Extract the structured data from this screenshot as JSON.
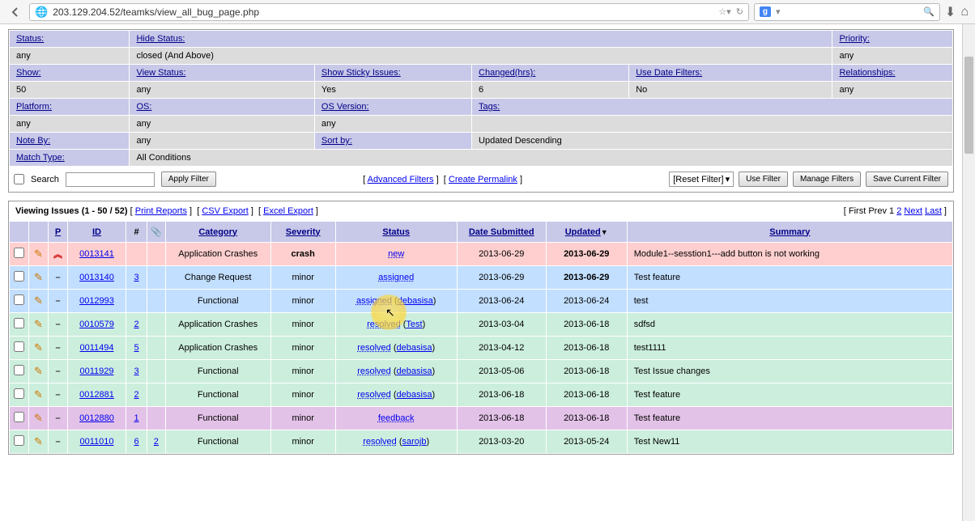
{
  "browser": {
    "url": "203.129.204.52/teamks/view_all_bug_page.php",
    "search_engine": "g"
  },
  "filter": {
    "row0": {
      "status": "Status:",
      "hide": "Hide Status:",
      "priority": "Priority:"
    },
    "row0v": {
      "any": "any",
      "closed": "closed (And Above)",
      "any2": "any"
    },
    "row1": {
      "show": "Show:",
      "view": "View Status:",
      "sticky": "Show Sticky Issues:",
      "changed": "Changed(hrs):",
      "datef": "Use Date Filters:",
      "rel": "Relationships:"
    },
    "row1v": {
      "show": "50",
      "view": "any",
      "sticky": "Yes",
      "changed": "6",
      "datef": "No",
      "rel": "any"
    },
    "row2": {
      "platform": "Platform:",
      "os": "OS:",
      "osv": "OS Version:",
      "tags": "Tags:"
    },
    "row2v": {
      "platform": "any",
      "os": "any",
      "osv": "any"
    },
    "row3": {
      "note": "Note By:",
      "noteVal": "any",
      "sort": "Sort by:",
      "sortVal": "Updated Descending"
    },
    "row4": {
      "match": "Match Type:",
      "matchVal": "All Conditions"
    },
    "footer": {
      "search": "Search",
      "apply": "Apply Filter",
      "advanced": "Advanced Filters",
      "permalink": "Create Permalink",
      "reset": "[Reset Filter]",
      "use": "Use Filter",
      "manage": "Manage Filters",
      "save": "Save Current Filter"
    }
  },
  "viewing": {
    "title": "Viewing Issues (1 - 50 / 52)",
    "print": "Print Reports",
    "csv": "CSV Export",
    "excel": "Excel Export",
    "pagination": {
      "first": "First",
      "prev": "Prev",
      "p1": "1",
      "p2": "2",
      "next": "Next",
      "last": "Last"
    }
  },
  "headers": {
    "p": "P",
    "id": "ID",
    "hash": "#",
    "category": "Category",
    "severity": "Severity",
    "status": "Status",
    "date": "Date Submitted",
    "updated": "Updated",
    "summary": "Summary"
  },
  "rows": [
    {
      "cls": "row-pink",
      "pri": "red",
      "id": "0013141",
      "num": "",
      "category": "Application Crashes",
      "severity": "crash",
      "sevBold": true,
      "status": "new",
      "assignee": "",
      "date": "2013-06-29",
      "updated": "2013-06-29",
      "updBold": true,
      "summary": "Module1--sesstion1---add button is not working"
    },
    {
      "cls": "row-blue",
      "pri": "dash",
      "id": "0013140",
      "num": "3",
      "category": "Change Request",
      "severity": "minor",
      "sevBold": false,
      "status": "assigned",
      "assignee": "",
      "date": "2013-06-29",
      "updated": "2013-06-29",
      "updBold": true,
      "summary": "Test feature"
    },
    {
      "cls": "row-blue",
      "pri": "dash",
      "id": "0012993",
      "num": "",
      "category": "Functional",
      "severity": "minor",
      "sevBold": false,
      "status": "assigned",
      "assignee": "debasisa",
      "date": "2013-06-24",
      "updated": "2013-06-24",
      "updBold": false,
      "summary": "test"
    },
    {
      "cls": "row-green",
      "pri": "dash",
      "id": "0010579",
      "num": "2",
      "category": "Application Crashes",
      "severity": "minor",
      "sevBold": false,
      "status": "resolved",
      "assignee": "Test",
      "date": "2013-03-04",
      "updated": "2013-06-18",
      "updBold": false,
      "summary": "sdfsd"
    },
    {
      "cls": "row-green",
      "pri": "dash",
      "id": "0011494",
      "num": "5",
      "category": "Application Crashes",
      "severity": "minor",
      "sevBold": false,
      "status": "resolved",
      "assignee": "debasisa",
      "date": "2013-04-12",
      "updated": "2013-06-18",
      "updBold": false,
      "summary": "test1111"
    },
    {
      "cls": "row-green",
      "pri": "dash",
      "id": "0011929",
      "num": "3",
      "category": "Functional",
      "severity": "minor",
      "sevBold": false,
      "status": "resolved",
      "assignee": "debasisa",
      "date": "2013-05-06",
      "updated": "2013-06-18",
      "updBold": false,
      "summary": "Test Issue changes"
    },
    {
      "cls": "row-green",
      "pri": "dash",
      "id": "0012881",
      "num": "2",
      "category": "Functional",
      "severity": "minor",
      "sevBold": false,
      "status": "resolved",
      "assignee": "debasisa",
      "date": "2013-06-18",
      "updated": "2013-06-18",
      "updBold": false,
      "summary": "Test feature"
    },
    {
      "cls": "row-purple",
      "pri": "dash",
      "id": "0012880",
      "num": "1",
      "category": "Functional",
      "severity": "minor",
      "sevBold": false,
      "status": "feedback",
      "assignee": "",
      "date": "2013-06-18",
      "updated": "2013-06-18",
      "updBold": false,
      "summary": "Test feature"
    },
    {
      "cls": "row-green",
      "pri": "dash",
      "id": "0011010",
      "num": "6",
      "num2": "2",
      "category": "Functional",
      "severity": "minor",
      "sevBold": false,
      "status": "resolved",
      "assignee": "sarojb",
      "date": "2013-03-20",
      "updated": "2013-05-24",
      "updBold": false,
      "summary": "Test New11"
    }
  ]
}
